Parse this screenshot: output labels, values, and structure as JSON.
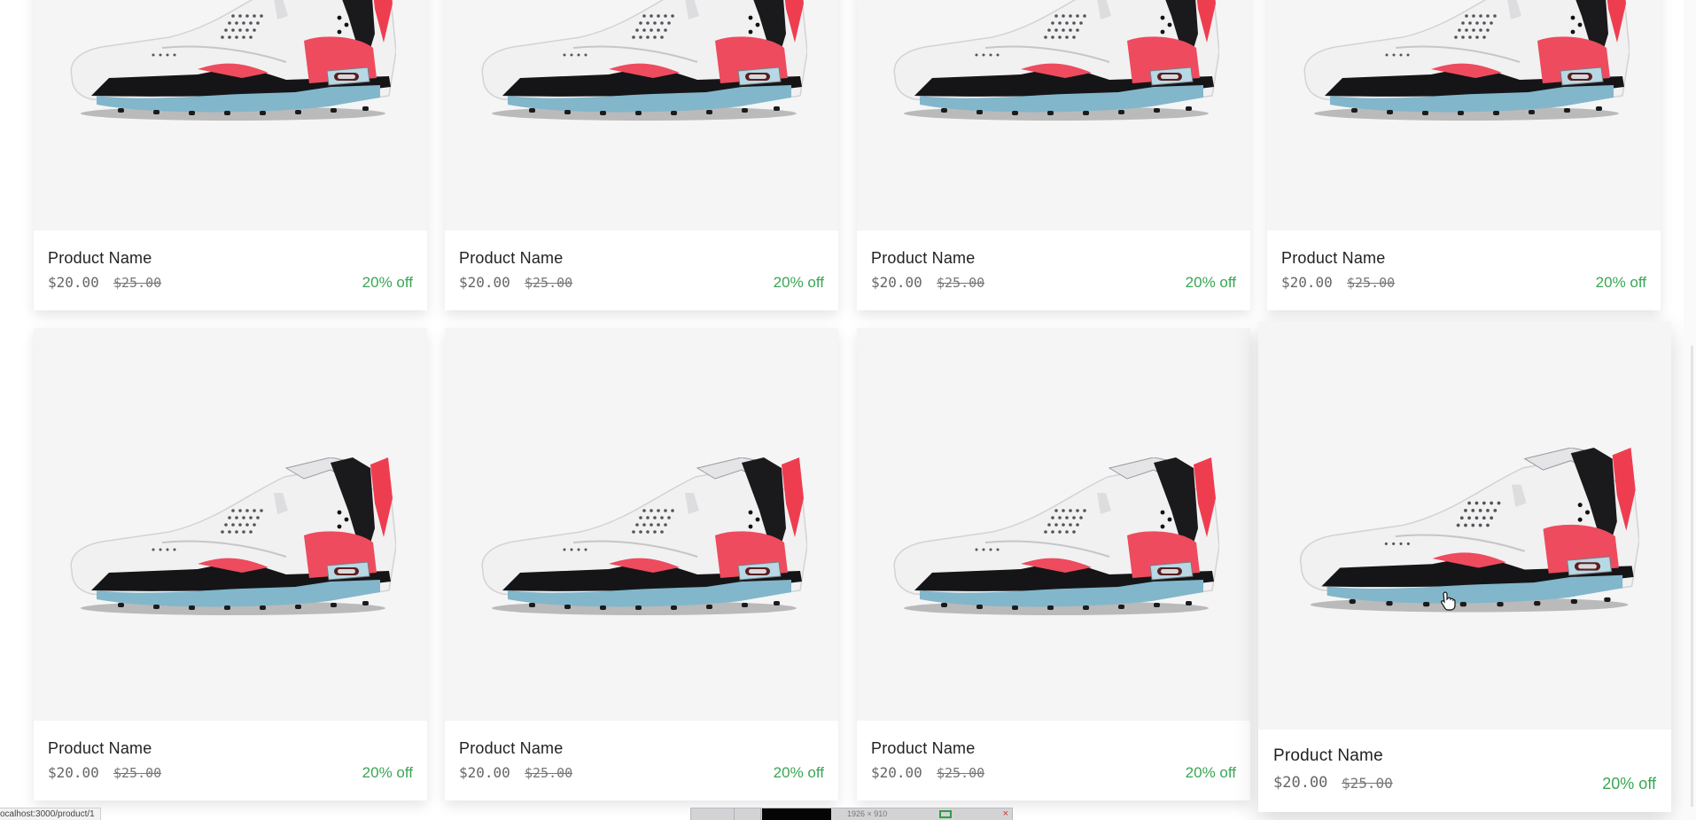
{
  "products": [
    {
      "name": "Product Name",
      "price": "$20.00",
      "old_price": "$25.00",
      "discount": "20% off"
    },
    {
      "name": "Product Name",
      "price": "$20.00",
      "old_price": "$25.00",
      "discount": "20% off"
    },
    {
      "name": "Product Name",
      "price": "$20.00",
      "old_price": "$25.00",
      "discount": "20% off"
    },
    {
      "name": "Product Name",
      "price": "$20.00",
      "old_price": "$25.00",
      "discount": "20% off"
    },
    {
      "name": "Product Name",
      "price": "$20.00",
      "old_price": "$25.00",
      "discount": "20% off"
    },
    {
      "name": "Product Name",
      "price": "$20.00",
      "old_price": "$25.00",
      "discount": "20% off"
    },
    {
      "name": "Product Name",
      "price": "$20.00",
      "old_price": "$25.00",
      "discount": "20% off"
    },
    {
      "name": "Product Name",
      "price": "$20.00",
      "old_price": "$25.00",
      "discount": "20% off",
      "state": "hovered"
    }
  ],
  "status_bar": {
    "url": "ocalhost:3000/product/1"
  },
  "bottom_tools": {
    "size_label": "1926 × 910"
  },
  "colors": {
    "discount_green": "#3aa655",
    "image_background": "#f5f5f6",
    "text_dark": "#222222"
  },
  "icons": {
    "product_image": "sneaker-image",
    "cursor": "hand-pointer-icon"
  }
}
